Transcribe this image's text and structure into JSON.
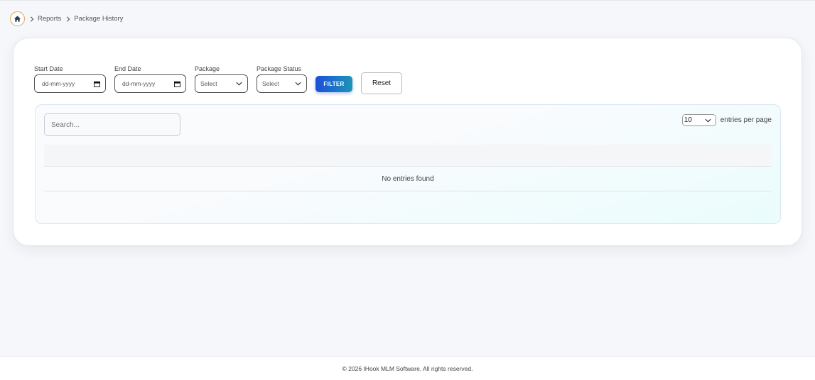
{
  "breadcrumb": {
    "home_icon": "home-icon",
    "items": [
      "Reports",
      "Package History"
    ]
  },
  "filters": {
    "start_date": {
      "label": "Start Date",
      "placeholder": "dd-mm-yyyy"
    },
    "end_date": {
      "label": "End Date",
      "placeholder": "dd-mm-yyyy"
    },
    "package": {
      "label": "Package",
      "value": "Select"
    },
    "package_status": {
      "label": "Package Status",
      "value": "Select"
    },
    "filter_label": "FILTER",
    "reset_label": "Reset"
  },
  "table": {
    "search_placeholder": "Search...",
    "per_page_value": "10",
    "per_page_label": "entries per page",
    "empty_text": "No entries found"
  },
  "footer": {
    "text": "© 2026 IHook MLM Software. All rights reserved."
  },
  "colors": {
    "accent_start": "#1d4fd8",
    "accent_end": "#1b96b8",
    "home_border": "#e0a85a"
  }
}
